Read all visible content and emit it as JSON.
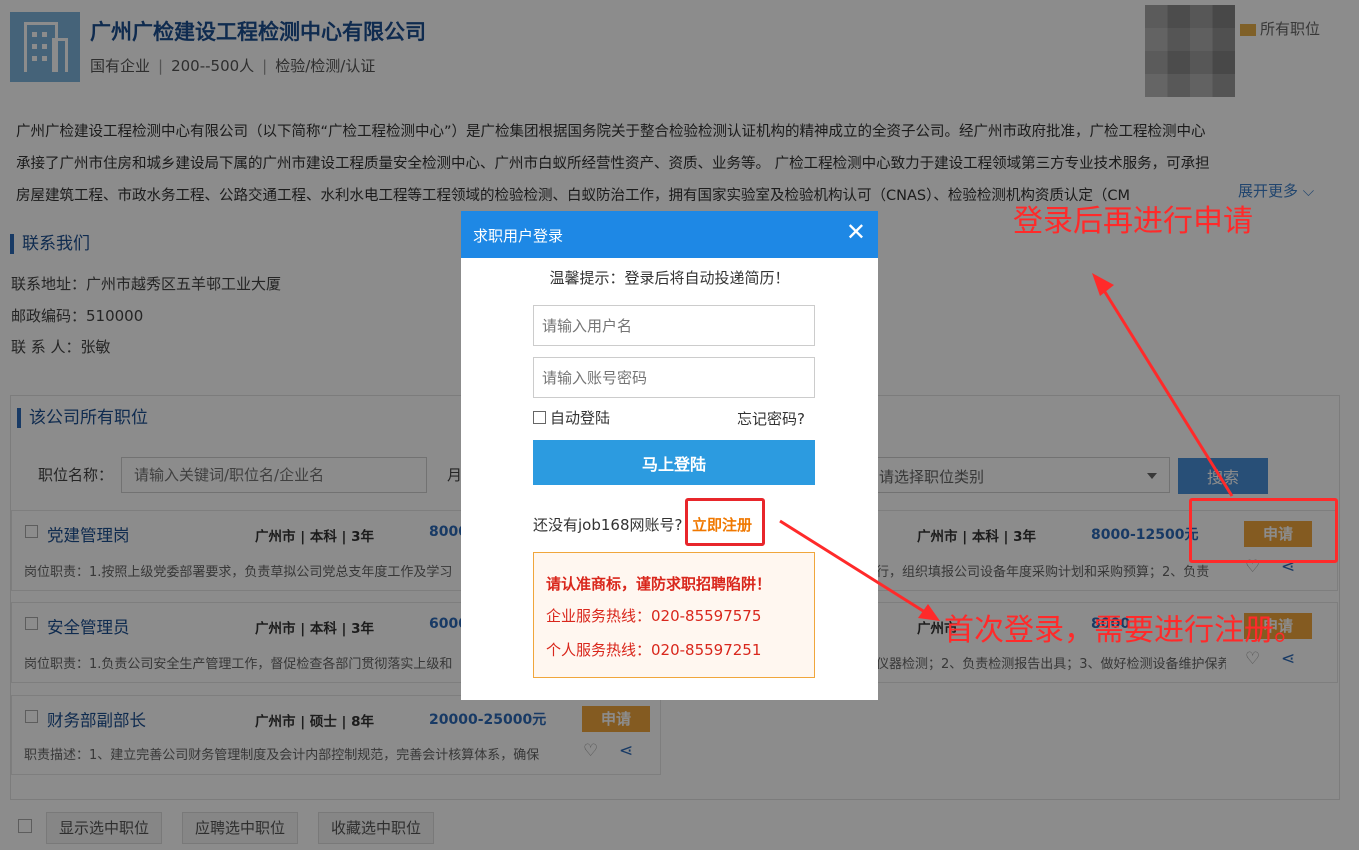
{
  "company": {
    "name": "广州广检建设工程检测中心有限公司",
    "type": "国有企业",
    "size": "200--500人",
    "industry": "检验/检测/认证",
    "all_jobs_link": "所有职位",
    "intro_lines": [
      "广州广检建设工程检测中心有限公司（以下简称“广检工程检测中心”）是广检集团根据国务院关于整合检验检测认证机构的精神成立的全资子公司。经广州市政府批准，广检工程检测中心",
      "承接了广州市住房和城乡建设局下属的广州市建设工程质量安全检测中心、广州市白蚁所经营性资产、资质、业务等。 广检工程检测中心致力于建设工程领域第三方专业技术服务，可承担",
      "房屋建筑工程、市政水务工程、公路交通工程、水利水电工程等工程领域的检验检测、白蚁防治工作，拥有国家实验室及检验机构认可（CNAS）、检验检测机构资质认定（CM"
    ],
    "expand_more": "展开更多"
  },
  "contact": {
    "title": "联系我们",
    "address": "联系地址：广州市越秀区五羊邨工业大厦",
    "postcode": "邮政编码：510000",
    "person": "联 系 人：张敏"
  },
  "jobs": {
    "title": "该公司所有职位",
    "search_label": "职位名称：",
    "search_placeholder": "请输入关键词/职位名/企业名",
    "month_label": "月",
    "category_placeholder": "请选择职位类别",
    "search_button": "搜索",
    "items": [
      {
        "title": "党建管理岗",
        "meta": "广州市 | 本科 | 3年",
        "salary": "8000",
        "desc": "岗位职责：1.按照上级党委部署要求，负责草拟公司党总支年度工作及学习"
      },
      {
        "title": "安全管理员",
        "meta": "广州市 | 本科 | 3年",
        "salary": "6000",
        "desc": "岗位职责：1.负责公司安全生产管理工作，督促检查各部门贯彻落实上级和"
      },
      {
        "title": "财务部副部长",
        "meta": "广州市 | 硕士 | 8年",
        "salary": "20000-25000元",
        "desc": "职责描述：1、建立完善公司财务管理制度及会计内部控制规范，完善会计核算体系，确保"
      }
    ],
    "right_items": [
      {
        "meta": "广州市 | 本科 | 3年",
        "salary": "8000-12500元",
        "desc": "行，组织填报公司设备年度采购计划和采购预算；2、负责"
      },
      {
        "meta": "广州市",
        "salary": "8000",
        "desc": "仪器检测；2、负责检测报告出具；3、做好检测设备维护保养"
      }
    ],
    "apply_label": "申请",
    "bottom_buttons": [
      "显示选中职位",
      "应聘选中职位",
      "收藏选中职位"
    ]
  },
  "modal": {
    "title": "求职用户登录",
    "close": "✕",
    "tip": "温馨提示：登录后将自动投递简历！",
    "username_placeholder": "请输入用户名",
    "password_placeholder": "请输入账号密码",
    "auto_login": "自动登陆",
    "forgot": "忘记密码?",
    "login_button": "马上登陆",
    "no_account": "还没有job168网账号?",
    "register": "立即注册",
    "warn_title": "请认准商标，谨防求职招聘陷阱！",
    "hotline_company": "企业服务热线：020-85597575",
    "hotline_personal": "个人服务热线：020-85597251"
  },
  "annotations": {
    "top": "登录后再进行申请",
    "bottom": "首次登录，需要进行注册。",
    "color": "#ff2a2a"
  },
  "colors": {
    "accent": "#1e88e5",
    "login_button": "#2c9be0",
    "apply": "#f0a63c",
    "warning": "#d9271c"
  }
}
